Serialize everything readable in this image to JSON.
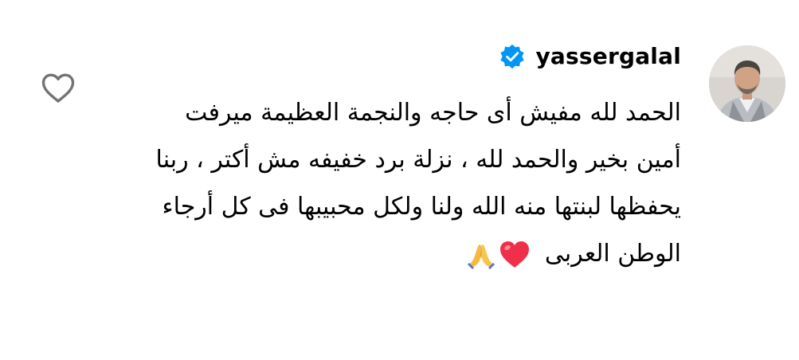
{
  "comment": {
    "username": "yassergalal",
    "verified": true,
    "lines": [
      "الحمد لله مفيش أى حاجه والنجمة العظيمة ميرفت",
      "أمين بخير والحمد لله ، نزلة برد خفيفه مش أكتر ، ربنا",
      "يحفظها لبنتها منه الله ولنا ولكل محبيبها فى كل أرجاء",
      "الوطن العربى"
    ],
    "trailing_emojis": [
      "folded-hands-emoji",
      "red-heart-emoji"
    ]
  },
  "icons": {
    "like": "heart-outline-icon",
    "verified": "verified-badge-icon"
  },
  "colors": {
    "verified_blue": "#0095F6",
    "icon_gray": "#737373",
    "heart_red": "#F0304A",
    "text": "#000000"
  }
}
